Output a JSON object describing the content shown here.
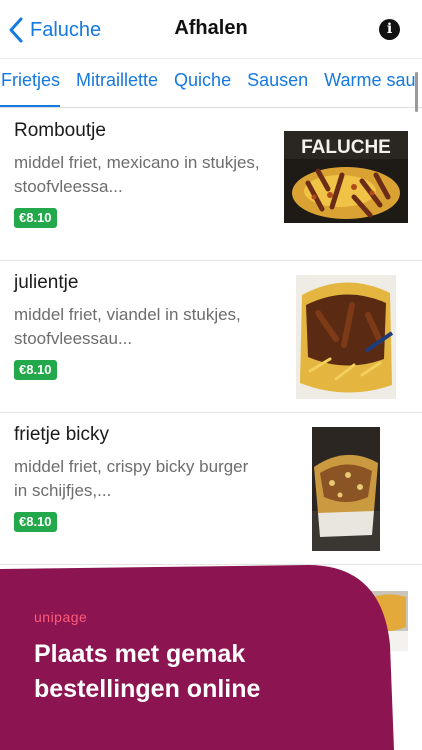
{
  "header": {
    "back_label": "Faluche",
    "title": "Afhalen",
    "info_icon": "info-icon",
    "info_glyph": "i"
  },
  "tabs": [
    {
      "label": "Frietjes",
      "active": true
    },
    {
      "label": "Mitraillette",
      "active": false
    },
    {
      "label": "Quiche",
      "active": false
    },
    {
      "label": "Sausen",
      "active": false
    },
    {
      "label": "Warme sau",
      "active": false
    }
  ],
  "products": [
    {
      "name": "Romboutje",
      "description": "middel friet, mexicano in stukjes, stoofvleessa...",
      "price": "€8.10",
      "image_label": "FALUCHE"
    },
    {
      "name": "julientje",
      "description": "middel friet, viandel in stukjes, stoofvleessau...",
      "price": "€8.10"
    },
    {
      "name": "frietje bicky",
      "description": "middel friet, crispy bicky burger in schijfjes,...",
      "price": "€8.10"
    }
  ],
  "promo": {
    "logo": "unipage",
    "headline": "Plaats met gemak bestellingen online"
  },
  "colors": {
    "accent": "#1479e0",
    "price_badge": "#23a94b",
    "promo_bg": "#8c1450",
    "promo_logo": "#ff5b7a"
  }
}
